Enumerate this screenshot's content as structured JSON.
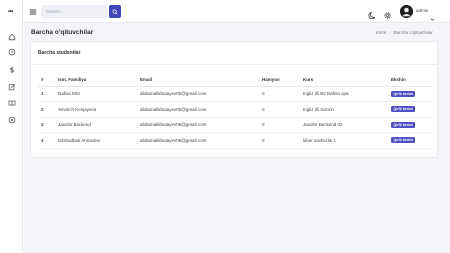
{
  "app": {
    "logo_text": "•••"
  },
  "sidebar": {
    "items": [
      {
        "icon": "home-icon"
      },
      {
        "icon": "clock-icon"
      },
      {
        "icon": "dollar-icon"
      },
      {
        "icon": "edit-icon"
      },
      {
        "icon": "book-icon"
      },
      {
        "icon": "settings-circle-icon"
      }
    ]
  },
  "header": {
    "search_placeholder": "Search...",
    "user_name": "admin"
  },
  "page": {
    "title": "Barcha o'qituvchilar",
    "breadcrumb": [
      "Kirim",
      "Barcha o'qituvchilar"
    ]
  },
  "card": {
    "title": "Barcha studentlar"
  },
  "table": {
    "columns": [
      "#",
      "Ism, Familiya",
      "Email",
      "Hamyon",
      "Kurs",
      "Ekshin"
    ],
    "rows": [
      {
        "no": "1",
        "name": "Nafisa Mirz",
        "email": "abdumalikbutayev05@gmail.com",
        "hamyon": "0",
        "kurs": "Ingliz tili B2 Nafisa opa",
        "action": "Qo'lk berish"
      },
      {
        "no": "2",
        "name": "Sevinch Kenjayeva",
        "email": "abdumalikbutayev05@gmail.com",
        "hamyon": "0",
        "kurs": "Ingliz tili Svinch",
        "action": "Qo'lk berish"
      },
      {
        "no": "3",
        "name": "Javohir backend",
        "email": "abdumalikbutayev05@gmail.com",
        "hamyon": "0",
        "kurs": "Javohir Beckend 02",
        "action": "Qo'lk berish"
      },
      {
        "no": "4",
        "name": "Dilshodbek Ahmedov",
        "email": "abdumalikbutayev05@gmail.com",
        "hamyon": "0",
        "kurs": "kiber xavfsizlik 1",
        "action": "Qo'lk berish"
      }
    ]
  },
  "colors": {
    "accent": "#3f47b6",
    "badge": "#4b4fc0",
    "background": "#f4f5f8"
  }
}
